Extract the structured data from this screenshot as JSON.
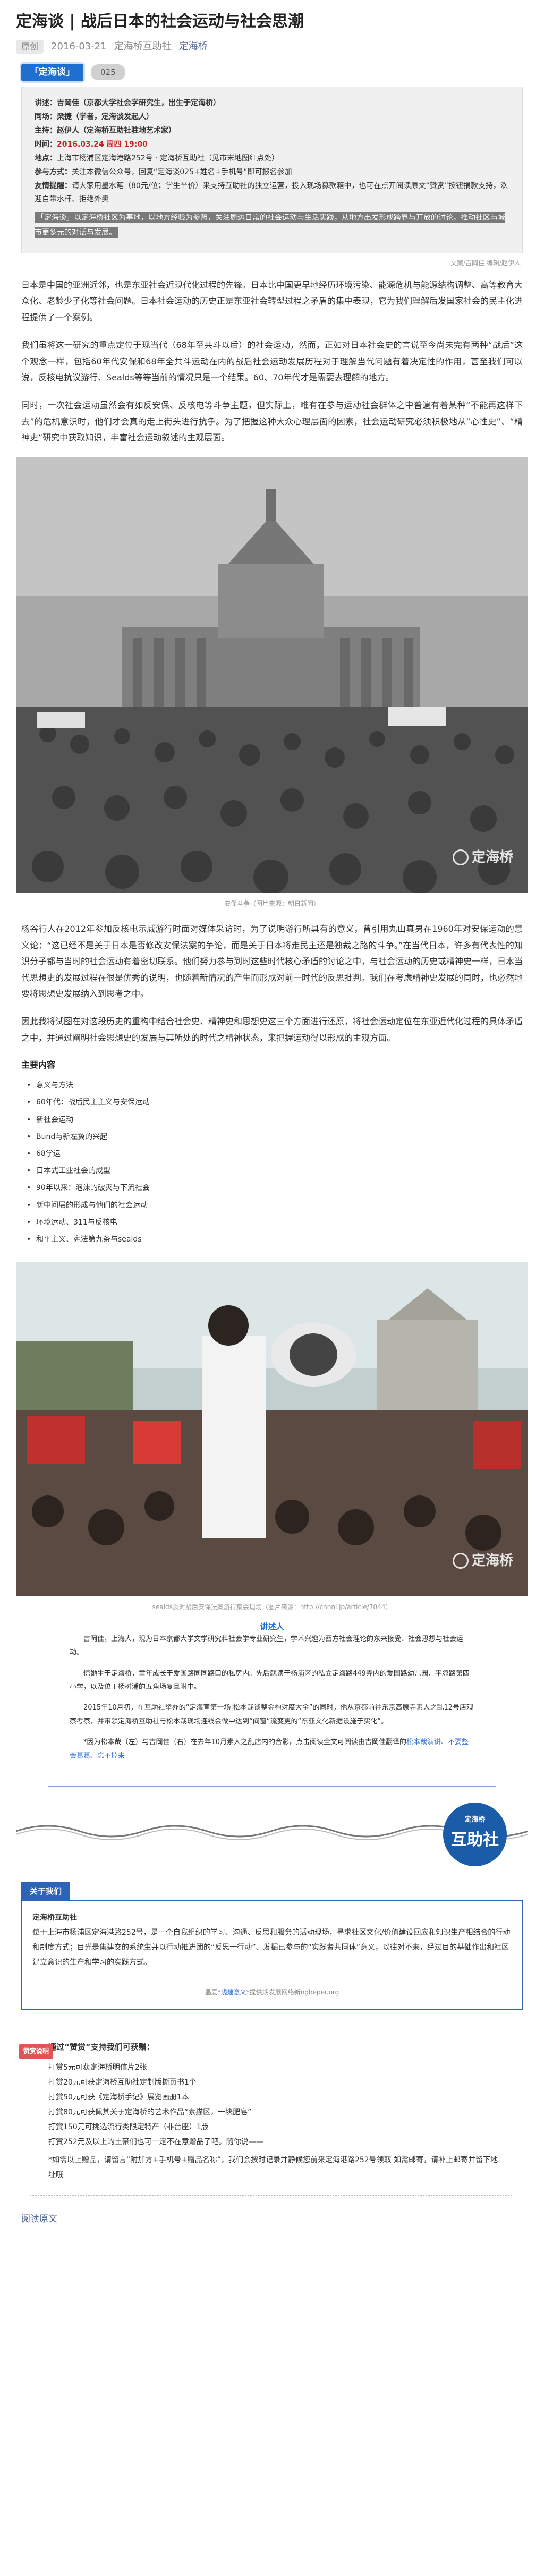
{
  "article": {
    "title": "定海谈 | 战后日本的社会运动与社会思潮",
    "original_badge": "原创",
    "date": "2016-03-21",
    "source": "定海桥互助社",
    "account": "定海桥"
  },
  "tags": {
    "column": "「定海谈」",
    "issue": "025"
  },
  "info": {
    "speaker_label": "讲述：",
    "speaker": "吉岡佳（京都大学社会学研究生，出生于定海桥）",
    "panelist_label": "同场：",
    "panelist": "梁捷（学者，定海谈发起人）",
    "host_label": "主持：",
    "host": "赵伊人（定海桥互助社驻地艺术家）",
    "time_label": "时间：",
    "time": "2016.03.24 周四 19:00",
    "place_label": "地点：",
    "place": "上海市杨浦区定海港路252号 · 定海桥互助社（见市末地图红点处）",
    "join_label": "参与方式：",
    "join": "关注本微信公众号，回复“定海谈025+姓名+手机号”即可报名参加",
    "tip_label": "友情提醒：",
    "tip": "请大家用墨水笔（80元/位；学生半价）来支持互助社的独立运营，投入现场募款箱中，也可在点开阅读原文“赞赏”按钮捐款支持，欢迎自带水杯、拒绝外卖",
    "strip": "「定海谈」以定海桥社区为基地，以地方经验为参照，关注周边日常的社会运动与生活实践，从地方出发形成跨界与开放的讨论，推动社区与城市更多元的对话与发展。"
  },
  "credit_top": "文案/吉岡佳  编辑/赵伊人",
  "paragraphs": [
    "日本是中国的亚洲近邻，也是东亚社会近现代化过程的先锋。日本比中国更早地经历环境污染、能源危机与能源结构调整、高等教育大众化、老龄少子化等社会问题。日本社会运动的历史正是东亚社会转型过程之矛盾的集中表现，它为我们理解后发国家社会的民主化进程提供了一个案例。",
    "我们虽将这一研究的重点定位于现当代（68年至共斗以后）的社会运动，然而，正如对日本社会史的言说至今尚未完有两种“战后”这个观念一样，包括60年代安保和68年全共斗运动在内的战后社会运动发展历程对于理解当代问题有着决定性的作用，甚至我们可以说，反核电抗议游行、Sealds等等当前的情况只是一个结果。60、70年代才是需要去理解的地方。",
    "同时，一次社会运动虽然会有如反安保、反核电等斗争主题，但实际上，唯有在参与运动社会群体之中普遍有着某种“不能再这样下去”的危机意识时，他们才会真的走上街头进行抗争。为了把握这种大众心理层面的因素，社会运动研究必须积极地从“心性史”、“精神史”研究中获取知识，丰富社会运动叙述的主观层面。",
    "杨谷行人在2012年参加反核电示威游行时面对媒体采访时，为了说明游行所具有的意义，曾引用丸山真男在1960年对安保运动的意义论：“这已经不是关于日本是否修改安保法案的争论，而是关于日本将走民主还是独裁之路的斗争。”在当代日本，许多有代表性的知识分子都与当时的社会运动有着密切联系。他们努力参与到时这些时代核心矛盾的讨论之中，与社会运动的历史或精神史一样，日本当代思想史的发展过程在很是优秀的说明，也随着新情况的产生而形成对前一时代的反思批判。我们在考虑精神史发展的同时，也必然地要将思想史发展纳入到思考之中。",
    "因此我将试图在对这段历史的重构中结合社会史、精神史和思想史这三个方面进行还原，将社会运动定位在东亚近代化过程的具体矛盾之中，并通过阐明社会思想史的发展与其所处的时代之精神状态，来把握运动得以形成的主观方面。"
  ],
  "photo1_caption": "安保斗争（图片来源：朝日新闻）",
  "photo2_caption": "sealds反对战后安保法案游行集会现场（图片来源：http://cnnnl.jp/article/7044）",
  "watermark_text": "定海桥",
  "topics": {
    "heading": "主要内容",
    "items": [
      "意义与方法",
      "60年代：战后民主主义与安保运动",
      "新社会运动",
      "Bund与新左翼的兴起",
      "68学运",
      "日本式工业社会的成型",
      "90年以来：泡沫的破灭与下流社会",
      "新中间层的形成与他们的社会运动",
      "环境运动、311与反核电",
      "和平主义、宪法第九条与sealds"
    ]
  },
  "speaker_box": {
    "title": "讲述人",
    "p1": "吉岡佳，上海人，现为日本京都大学文学研究科社会学专业研究生，学术兴趣为西方社会理论的东来接受、社会思想与社会运动。",
    "p2": "惊她生于定海桥，童年成长于爱国路同同路口的私房内。先后就读于杨浦区的私立定海路449弄内的爱国路幼儿园、平凉路第四小学，以及位于杨树浦的五角场复旦附中。",
    "p3": "2015年10月初，在互助社举办的“定海宣第一场|松本哉谈整金构对魔大金”的同时，他从京都前往东京高原寺素人之乱12号店观察考察，并带领定海桥互助社与松本哉现场连线会做中达到“间窗”流变更的“东亚文化新据设施于实化”。",
    "p4": "*因为松本哉（左）与吉岡佳（右）在去年10月素人之乱店内的合影，点击阅读全文可阅读由吉岡佳翻译的",
    "link": "松本哉演讲、不要整会葛葛、忘不掉来"
  },
  "logo": {
    "top": "定海桥",
    "bottom": "互助社"
  },
  "about": {
    "heading": "关于我们",
    "name": "定海桥互助社",
    "desc": "位于上海市杨浦区定海港路252号，是一个自我组织的学习、沟通、反思和服务的活动现场，寻求社区文化/价值建设回应和知识生产相结合的行动和制度方式；目光是集建交的系统生并以行动推进团的“反思一行动”、发掘已参与的“实践者共同体”意义，以往对不来，经过目的基础作出和社区建立意识的生产和学习的实践方式。",
    "foot_prefix": "晶爱*",
    "foot_link": "浅建意义",
    "foot_suffix": "*提供期发展网络新ngheper.org"
  },
  "donate": {
    "badge": "赞赏说明",
    "headline": "通过“赞赏”支持我们可获赠：",
    "lines": [
      "打赏5元可获定海桥明信片2张",
      "打赏20元可获定海桥互助社定制版撕页书1个",
      "打赏50元可获《定海桥手记》展览画册1本",
      "打赏80元可获佩其关于定海桥的艺术作品“素描区，一块肥皂”",
      "打赏150元可挑选流行类限定特产（非台座）1版",
      "打赏252元及以上的土豪们也可一定不在意赠品了吧。随你说——"
    ],
    "note": "*如需以上赠品，请留言“附加方+手机号+赠品名称”，我们会按时记录并静候您前来定海港路252号领取 如需邮寄，请补上邮寄并留下地址哦"
  },
  "read_more": "阅读原文"
}
